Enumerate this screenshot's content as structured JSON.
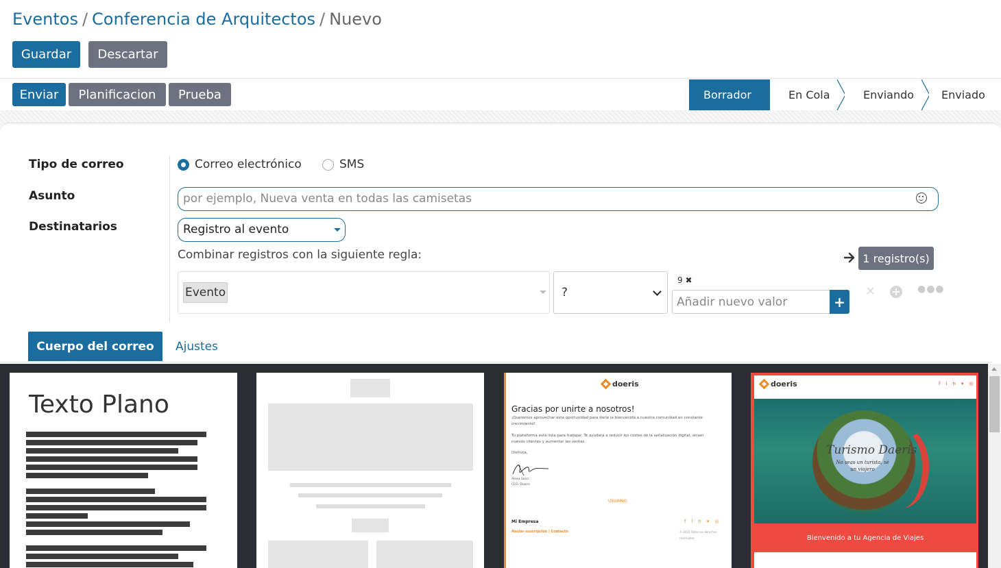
{
  "breadcrumb": {
    "level1": "Eventos",
    "level2": "Conferencia de Arquitectos",
    "current": "Nuevo",
    "separator": "/"
  },
  "form_actions": {
    "save": "Guardar",
    "discard": "Descartar"
  },
  "header_actions": {
    "send": "Enviar",
    "schedule": "Planificacion",
    "test": "Prueba"
  },
  "status_stages": [
    {
      "label": "Borrador",
      "active": true
    },
    {
      "label": "En Cola",
      "active": false
    },
    {
      "label": "Enviando",
      "active": false
    },
    {
      "label": "Enviado",
      "active": false
    }
  ],
  "fields": {
    "mail_type": {
      "label": "Tipo de correo",
      "options": [
        {
          "label": "Correo electrónico",
          "checked": true
        },
        {
          "label": "SMS",
          "checked": false
        }
      ]
    },
    "subject": {
      "label": "Asunto",
      "value": "",
      "placeholder": "por ejemplo, Nueva venta en todas las camisetas",
      "emoji_icon": "smiley-icon"
    },
    "recipients": {
      "label": "Destinatarios",
      "value": "Registro al evento",
      "combine_text": "Combinar registros con la siguiente regla:",
      "records_button": "1 registro(s)",
      "rule": {
        "field_tag": "Evento",
        "operator": "?",
        "value_count": "9",
        "value_placeholder": "Añadir nuevo valor"
      }
    }
  },
  "tabs": [
    {
      "label": "Cuerpo del correo",
      "active": true
    },
    {
      "label": "Ajustes",
      "active": false
    }
  ],
  "templates": {
    "plain_text": {
      "title": "Texto Plano"
    },
    "welcome": {
      "brand": "doeris",
      "heading": "Gracias por unirte a nosotros!",
      "para1": "¡Queremos aprovechar esta oportunidad para darle la bienvenida a nuestra comunidad en constante crecimiento!",
      "para2": "Tu plataforma está lista para trabajar. Te ayudará a reducir los costes de la señalización digital, atraer nuevos clientes y aumentar las ventas.",
      "sign_off": "Disfruta,",
      "signer_name": "Alexa Sanz",
      "signer_role": "CEO, Doeris",
      "user_label": "USUARIO",
      "company": "Mi Empresa",
      "unsubscribe": "Anular suscripción",
      "contact": "Contacto",
      "copyright": "© 2022 Todos los derechos reservados"
    },
    "travel": {
      "brand": "doeris",
      "hero_title": "Turismo Daeris",
      "hero_sub": "No seas un turista, sé un viajero",
      "banner": "Bienvenido a tu Agencia de Viajes"
    }
  },
  "colors": {
    "primary": "#1a6d9e",
    "secondary": "#6c7280",
    "brand_orange": "#f08a24",
    "brand_red": "#ee4a3f"
  }
}
